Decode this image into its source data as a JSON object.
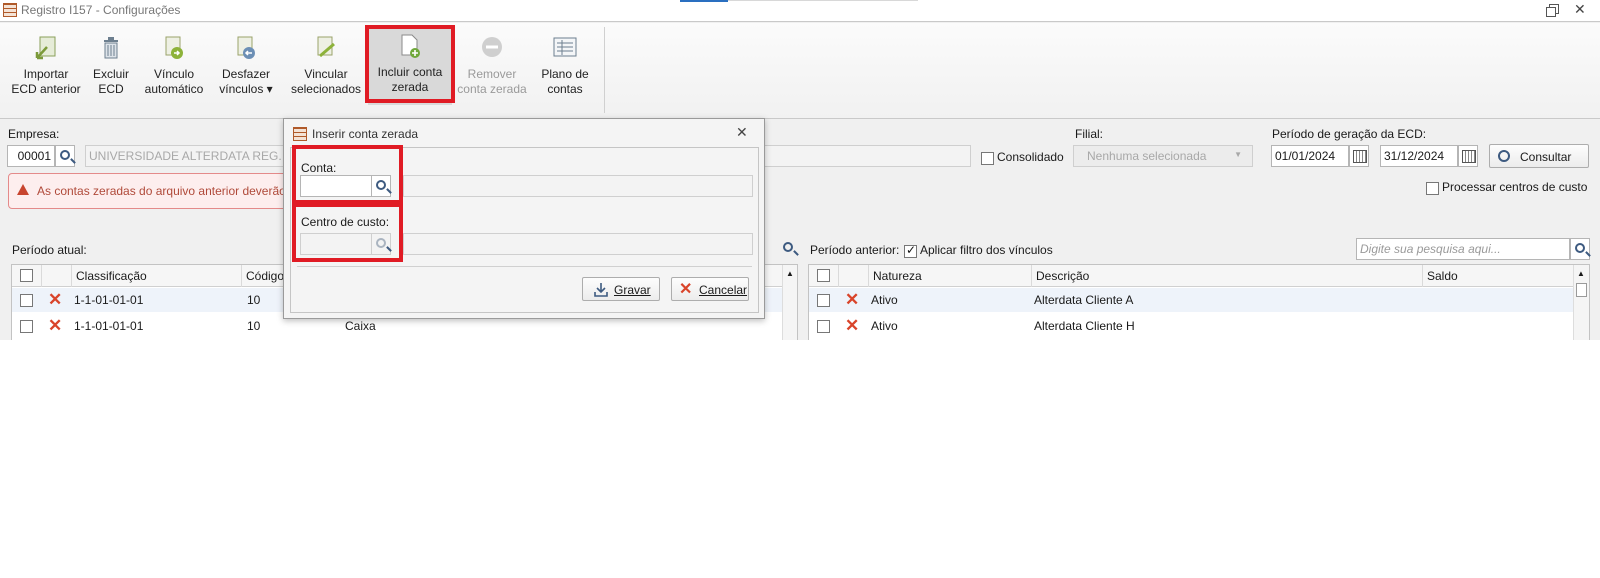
{
  "window": {
    "title": "Registro I157 - Configurações"
  },
  "toolbar": {
    "importar_l1": "Importar",
    "importar_l2": "ECD anterior",
    "excluir_l1": "Excluir",
    "excluir_l2": "ECD",
    "vinculo_l1": "Vínculo",
    "vinculo_l2": "automático",
    "desfazer_l1": "Desfazer",
    "desfazer_l2": "vínculos ▾",
    "vincular_l1": "Vincular",
    "vincular_l2": "selecionados",
    "incluir_l1": "Incluir conta",
    "incluir_l2": "zerada",
    "remover_l1": "Remover",
    "remover_l2": "conta zerada",
    "plano_l1": "Plano de",
    "plano_l2": "contas"
  },
  "form": {
    "empresa_label": "Empresa:",
    "empresa_code": "00001",
    "empresa_name": "UNIVERSIDADE ALTERDATA REG. CX. L",
    "consolidado_label": "Consolidado",
    "filial_label": "Filial:",
    "filial_value": "Nenhuma selecionada",
    "periodo_label": "Período de geração da ECD:",
    "data_inicio": "01/01/2024",
    "data_fim": "31/12/2024",
    "consultar_label": "Consultar",
    "processar_label": "Processar centros de custo"
  },
  "alert": {
    "text": "As contas zeradas do arquivo anterior deverão s"
  },
  "left_grid": {
    "label": "Período atual:",
    "columns": [
      "Classificação",
      "Código"
    ],
    "rows": [
      {
        "classificacao": "1-1-01-01-01",
        "codigo": "10",
        "descricao": ""
      },
      {
        "classificacao": "1-1-01-01-01",
        "codigo": "10",
        "descricao": "Caixa"
      }
    ]
  },
  "right_grid": {
    "label": "Período anterior:",
    "filter_label": "Aplicar filtro dos vínculos",
    "filter_checked": true,
    "search_placeholder": "Digite sua pesquisa aqui...",
    "columns": [
      "Natureza",
      "Descrição",
      "Saldo"
    ],
    "rows": [
      {
        "natureza": "Ativo",
        "descricao": "Alterdata Cliente A",
        "saldo": ""
      },
      {
        "natureza": "Ativo",
        "descricao": "Alterdata Cliente H",
        "saldo": ""
      }
    ]
  },
  "dialog": {
    "title": "Inserir conta zerada",
    "conta_label": "Conta:",
    "conta_value": "",
    "centro_label": "Centro de custo:",
    "centro_value": "",
    "gravar_label": "Gravar",
    "cancelar_label": "Cancelar"
  },
  "colors": {
    "highlight": "#e01b24",
    "alert_text": "#b04a3a",
    "delete_x": "#d9442a"
  }
}
